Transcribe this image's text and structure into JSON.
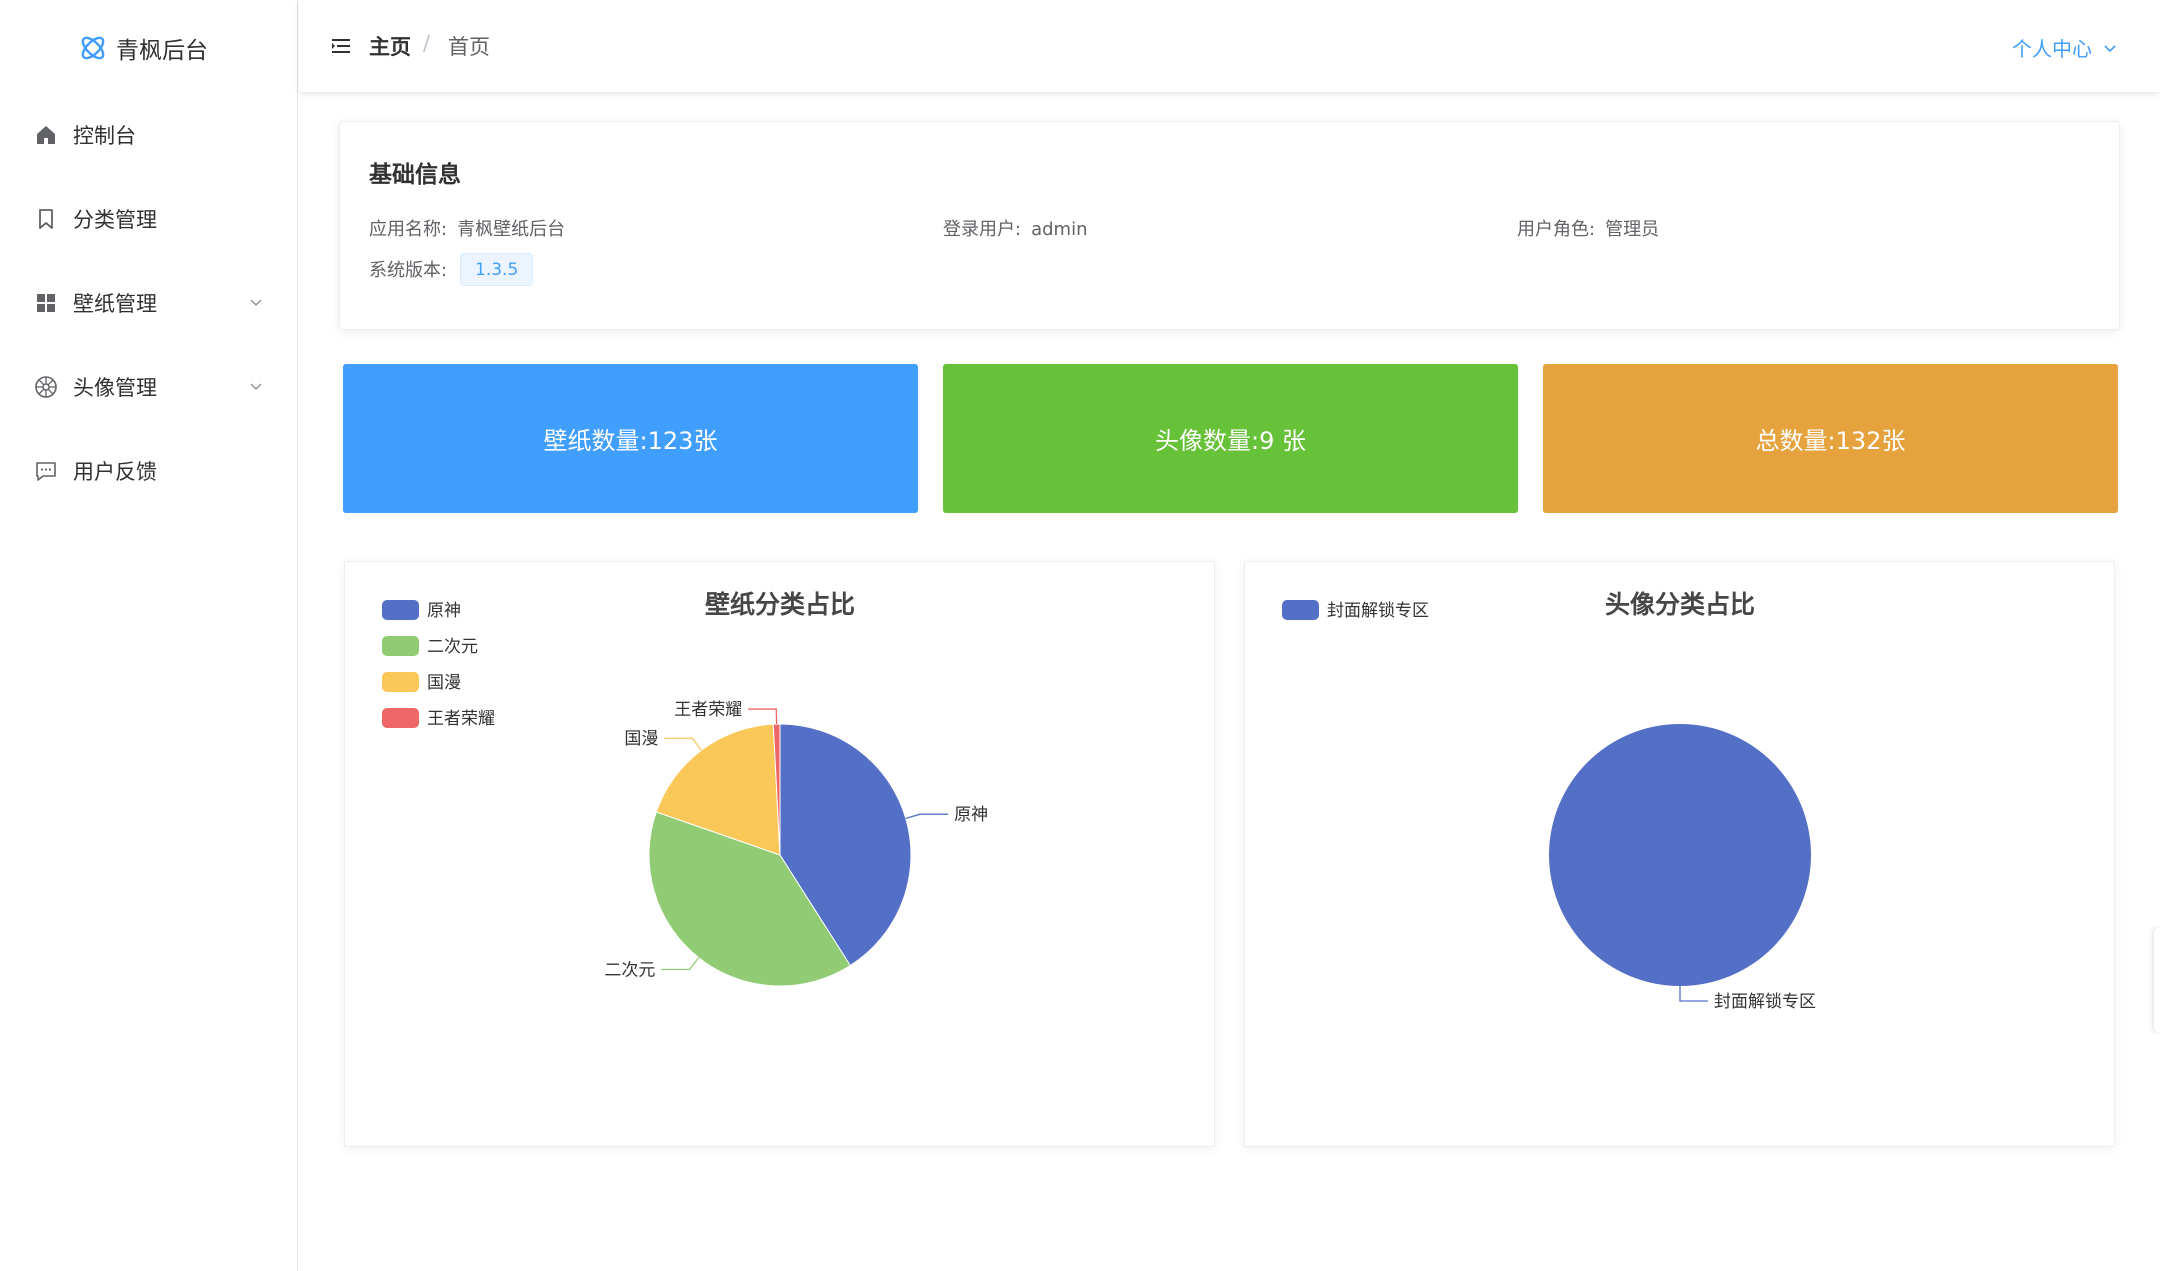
{
  "app": {
    "title": "青枫后台"
  },
  "sidebar": {
    "items": [
      {
        "label": "控制台",
        "icon": "home-icon"
      },
      {
        "label": "分类管理",
        "icon": "bookmark-icon"
      },
      {
        "label": "壁纸管理",
        "icon": "grid-icon",
        "expandable": true
      },
      {
        "label": "头像管理",
        "icon": "aperture-icon",
        "expandable": true
      },
      {
        "label": "用户反馈",
        "icon": "chat-icon"
      }
    ]
  },
  "header": {
    "breadcrumb": [
      "主页",
      "首页"
    ],
    "breadcrumb_sep": "/",
    "user_menu": "个人中心"
  },
  "info": {
    "title": "基础信息",
    "app_name_label": "应用名称:",
    "app_name": "青枫壁纸后台",
    "login_user_label": "登录用户:",
    "login_user": "admin",
    "role_label": "用户角色:",
    "role": "管理员",
    "version_label": "系统版本:",
    "version": "1.3.5"
  },
  "stats": [
    {
      "text": "壁纸数量:123张",
      "color": "#409eff"
    },
    {
      "text": "头像数量:9 张",
      "color": "#67c23a"
    },
    {
      "text": "总数量:132张",
      "color": "#e6a23c"
    }
  ],
  "colors": {
    "accent": "#409eff",
    "pie1": "#5470c6",
    "pie2": "#91cc75",
    "pie3": "#fac858",
    "pie4": "#ee6666"
  },
  "chart_data": [
    {
      "type": "pie",
      "title": "壁纸分类占比",
      "legend": "top-left",
      "categories": [
        "原神",
        "二次元",
        "国漫",
        "王者荣耀"
      ],
      "values": [
        50,
        48,
        23,
        1
      ],
      "colors": [
        "#5470c6",
        "#91cc75",
        "#fac858",
        "#ee6666"
      ]
    },
    {
      "type": "pie",
      "title": "头像分类占比",
      "legend": "top-left",
      "categories": [
        "封面解锁专区"
      ],
      "values": [
        9
      ],
      "colors": [
        "#5470c6"
      ]
    }
  ]
}
